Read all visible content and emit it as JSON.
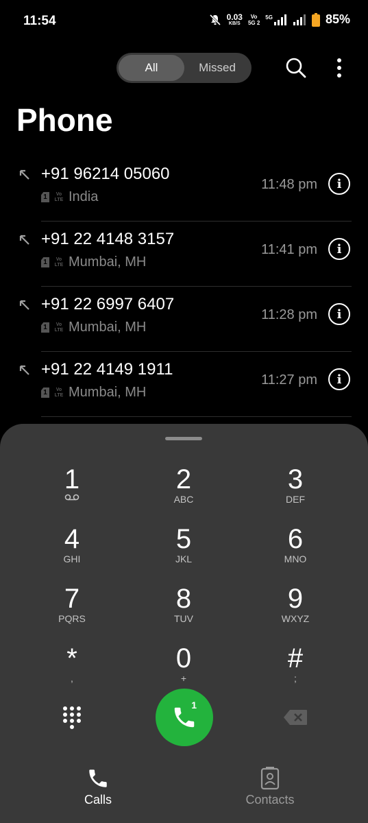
{
  "status_bar": {
    "time": "11:54",
    "net_speed_value": "0.03",
    "net_speed_unit": "KB/S",
    "volte_label_top": "Vo",
    "volte_label_bottom": "5G 2",
    "network_label": "5G",
    "battery_percent": "85%",
    "battery_color": "#f5a623"
  },
  "toolbar": {
    "tab_all": "All",
    "tab_missed": "Missed",
    "search_icon": "search-icon",
    "more_icon": "more-vertical-icon"
  },
  "page_title": "Phone",
  "calls": [
    {
      "number": "+91 96214 05060",
      "sim": "1",
      "volte": "Vo\nLTE",
      "location": "India",
      "time": "11:48 pm",
      "direction": "outgoing"
    },
    {
      "number": "+91 22 4148 3157",
      "sim": "1",
      "volte": "Vo\nLTE",
      "location": "Mumbai, MH",
      "time": "11:41 pm",
      "direction": "outgoing"
    },
    {
      "number": "+91 22 6997 6407",
      "sim": "1",
      "volte": "Vo\nLTE",
      "location": "Mumbai, MH",
      "time": "11:28 pm",
      "direction": "outgoing"
    },
    {
      "number": "+91 22 4149 1911",
      "sim": "1",
      "volte": "Vo\nLTE",
      "location": "Mumbai, MH",
      "time": "11:27 pm",
      "direction": "outgoing"
    }
  ],
  "dialpad": {
    "keys": [
      {
        "digit": "1",
        "letters": ""
      },
      {
        "digit": "2",
        "letters": "ABC"
      },
      {
        "digit": "3",
        "letters": "DEF"
      },
      {
        "digit": "4",
        "letters": "GHI"
      },
      {
        "digit": "5",
        "letters": "JKL"
      },
      {
        "digit": "6",
        "letters": "MNO"
      },
      {
        "digit": "7",
        "letters": "PQRS"
      },
      {
        "digit": "8",
        "letters": "TUV"
      },
      {
        "digit": "9",
        "letters": "WXYZ"
      },
      {
        "digit": "*",
        "letters": ","
      },
      {
        "digit": "0",
        "letters": "+"
      },
      {
        "digit": "#",
        "letters": ";"
      }
    ],
    "call_sim": "1",
    "call_color": "#23b33d"
  },
  "bottom_nav": {
    "calls_label": "Calls",
    "contacts_label": "Contacts"
  }
}
